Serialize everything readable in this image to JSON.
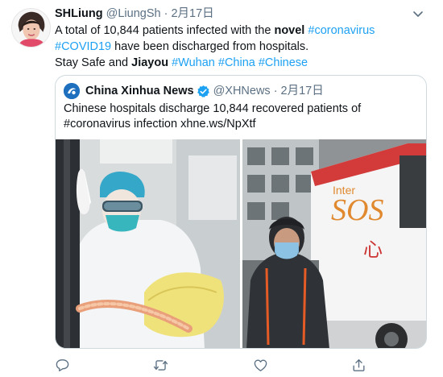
{
  "tweet": {
    "author_name": "SHLiung",
    "author_handle": "@LiungSh",
    "separator": "·",
    "date": "2月17日",
    "text_line1_a": "A total of 10,844 patients infected with the ",
    "text_line1_b": "novel",
    "text_line1_c": " ",
    "text_line1_tag": "#coronavirus",
    "text_line2_tag": "#COVID19",
    "text_line2_b": " have been discharged from hospitals.",
    "text_line3_a": "Stay Safe and ",
    "text_line3_b": "Jiayou",
    "text_line3_c": " ",
    "text_line3_tag1": "#Wuhan",
    "text_line3_tag2": "#China",
    "text_line3_tag3": "#Chinese",
    "icons": {
      "more": "chevron-down-icon"
    }
  },
  "quoted": {
    "author_name": "China Xinhua News",
    "author_handle": "@XHNews",
    "separator": "·",
    "date": "2月17日",
    "text_line1": "Chinese hospitals discharge 10,844 recovered patients of",
    "text_line2": "#coronavirus infection xhne.ws/NpXtf",
    "media_left_label": "Inter",
    "media_right_label": "SOS"
  },
  "actions": {
    "icons": [
      "reply-icon",
      "retweet-icon",
      "like-icon",
      "share-icon"
    ]
  },
  "colors": {
    "accent": "#1da1f2",
    "secondary_text": "#5b7083",
    "border": "#cfd9de"
  }
}
